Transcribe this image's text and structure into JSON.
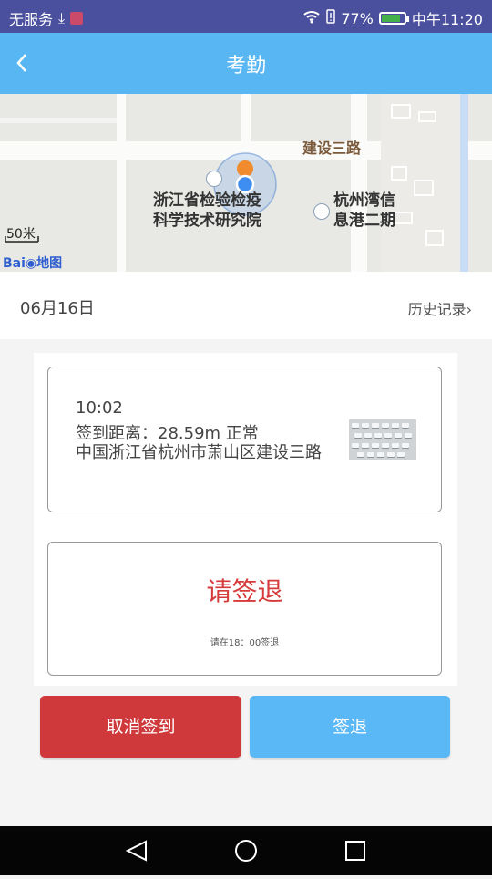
{
  "status_bar": {
    "carrier": "无服务",
    "battery": "77%",
    "battery_level": 0.77,
    "time": "中午11:20",
    "icons": [
      "download-icon",
      "app-notification-icon",
      "wifi-icon",
      "alert-icon",
      "battery-icon"
    ]
  },
  "app_bar": {
    "title": "考勤",
    "back_icon": "back-icon"
  },
  "map": {
    "road_label": "建设三路",
    "poi_1": {
      "line1": "浙江省检验检疫",
      "line2": "科学技术研究院"
    },
    "poi_2": {
      "line1": "杭州湾信",
      "line2": "息港二期"
    },
    "scale": "50米",
    "logo_part1": "Bai",
    "logo_part2": "地图"
  },
  "date_row": {
    "date": "06月16日",
    "history": "历史记录"
  },
  "checkin_card": {
    "time": "10:02",
    "distance": "签到距离：28.59m  正常",
    "address": "中国浙江省杭州市萧山区建设三路"
  },
  "checkout_card": {
    "main": "请签退",
    "sub": "请在18：00签退"
  },
  "buttons": {
    "cancel": "取消签到",
    "checkout": "签退"
  },
  "colors": {
    "status_bar": "#4a4f9e",
    "app_bar": "#58b6f2",
    "cancel_button": "#d0393b",
    "checkout_button": "#5bb8f6",
    "alert_text": "#d63a3a"
  }
}
